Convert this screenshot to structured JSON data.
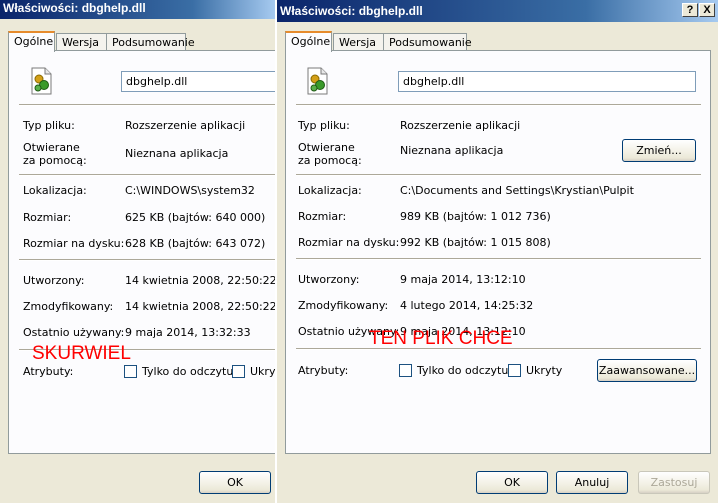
{
  "left": {
    "title": "Właściwości: dbghelp.dll",
    "tabs": [
      "Ogólne",
      "Wersja",
      "Podsumowanie"
    ],
    "file_name": "dbghelp.dll",
    "type_label": "Typ pliku:",
    "type_value": "Rozszerzenie aplikacji",
    "opens_label_1": "Otwierane",
    "opens_label_2": "za pomocą:",
    "opens_value": "Nieznana aplikacja",
    "location_label": "Lokalizacja:",
    "location_value": "C:\\WINDOWS\\system32",
    "size_label": "Rozmiar:",
    "size_value": "625 KB (bajtów: 640 000)",
    "disk_label": "Rozmiar na dysku:",
    "disk_value": "628 KB (bajtów: 643 072)",
    "created_label": "Utworzony:",
    "created_value": "14 kwietnia 2008, 22:50:22",
    "modified_label": "Zmodyfikowany:",
    "modified_value": "14 kwietnia 2008, 22:50:22",
    "accessed_label": "Ostatnio używany:",
    "accessed_value": "9 maja 2014, 13:32:33",
    "attrs_label": "Atrybuty:",
    "readonly_label": "Tylko do odczytu",
    "hidden_label": "Ukryty",
    "ok_label": "OK",
    "overlay_text": "SKURWIEL"
  },
  "right": {
    "title": "Właściwości: dbghelp.dll",
    "help_glyph": "?",
    "close_glyph": "X",
    "tabs": [
      "Ogólne",
      "Wersja",
      "Podsumowanie"
    ],
    "file_name": "dbghelp.dll",
    "type_label": "Typ pliku:",
    "type_value": "Rozszerzenie aplikacji",
    "opens_label_1": "Otwierane",
    "opens_label_2": "za pomocą:",
    "opens_value": "Nieznana aplikacja",
    "change_label": "Zmień...",
    "location_label": "Lokalizacja:",
    "location_value": "C:\\Documents and Settings\\Krystian\\Pulpit",
    "size_label": "Rozmiar:",
    "size_value": "989 KB (bajtów: 1 012 736)",
    "disk_label": "Rozmiar na dysku:",
    "disk_value": "992 KB (bajtów: 1 015 808)",
    "created_label": "Utworzony:",
    "created_value": "9 maja 2014, 13:12:10",
    "modified_label": "Zmodyfikowany:",
    "modified_value": "4 lutego 2014, 14:25:32",
    "accessed_label": "Ostatnio używany:",
    "accessed_value": "9 maja 2014, 13:12:10",
    "attrs_label": "Atrybuty:",
    "readonly_label": "Tylko do odczytu",
    "hidden_label": "Ukryty",
    "advanced_label": "Zaawansowane...",
    "ok_label": "OK",
    "cancel_label": "Anuluj",
    "apply_label": "Zastosuj",
    "overlay_text": "TEN PLIK CHCE"
  }
}
